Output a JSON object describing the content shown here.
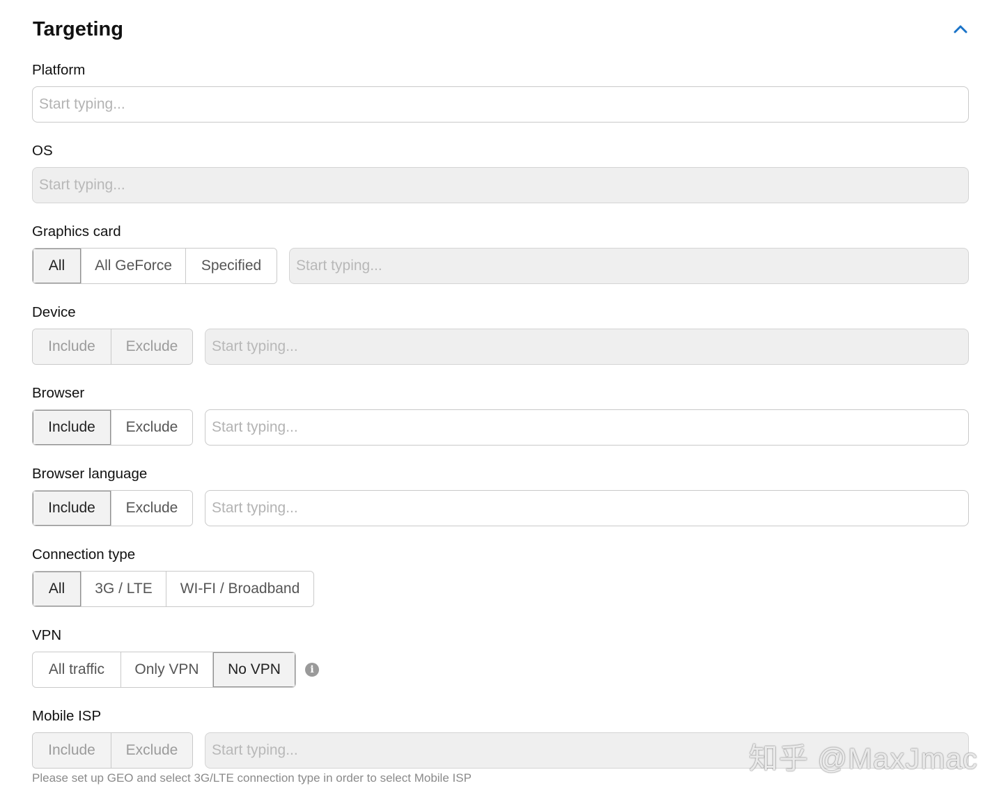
{
  "section": {
    "title": "Targeting"
  },
  "colors": {
    "accent": "#1a73c8"
  },
  "icons": {
    "collapse": "chevron-up-icon",
    "info": "info-icon"
  },
  "placeholder": "Start typing...",
  "platform": {
    "label": "Platform"
  },
  "os": {
    "label": "OS"
  },
  "graphics_card": {
    "label": "Graphics card",
    "options": [
      "All",
      "All GeForce",
      "Specified"
    ],
    "selected": "All"
  },
  "device": {
    "label": "Device",
    "options": [
      "Include",
      "Exclude"
    ],
    "selected": "Include"
  },
  "browser": {
    "label": "Browser",
    "options": [
      "Include",
      "Exclude"
    ],
    "selected": "Include"
  },
  "browser_language": {
    "label": "Browser language",
    "options": [
      "Include",
      "Exclude"
    ],
    "selected": "Include"
  },
  "connection_type": {
    "label": "Connection type",
    "options": [
      "All",
      "3G / LTE",
      "WI-FI / Broadband"
    ],
    "selected": "All"
  },
  "vpn": {
    "label": "VPN",
    "options": [
      "All traffic",
      "Only VPN",
      "No VPN"
    ],
    "selected": "No VPN"
  },
  "mobile_isp": {
    "label": "Mobile ISP",
    "options": [
      "Include",
      "Exclude"
    ],
    "selected": "Include",
    "hint": "Please set up GEO and select 3G/LTE connection type in order to select Mobile ISP"
  },
  "watermark": "知乎 @MaxJmac"
}
